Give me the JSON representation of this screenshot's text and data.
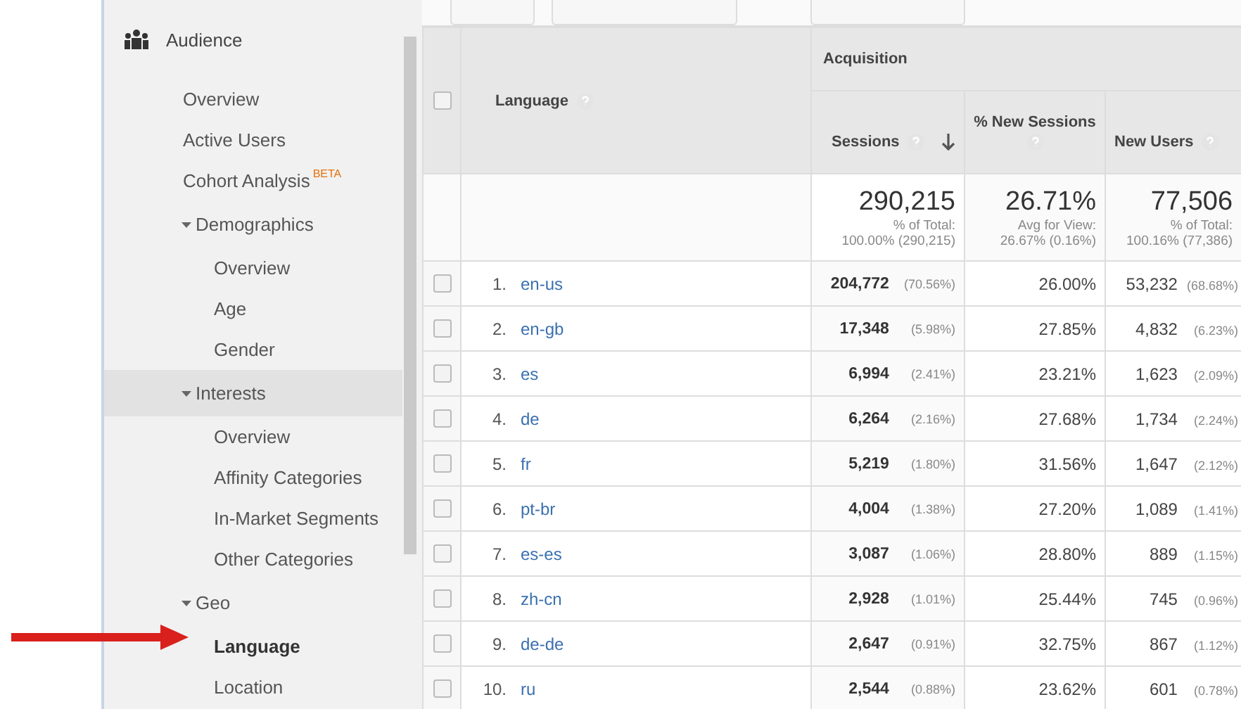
{
  "sidebar": {
    "section": {
      "label": "Audience",
      "children": [
        {
          "label": "Overview",
          "selected": false,
          "hovered": false
        },
        {
          "label": "Active Users",
          "selected": false,
          "hovered": false
        },
        {
          "label": "Cohort Analysis",
          "badge": "BETA",
          "selected": false,
          "hovered": false
        },
        {
          "label": "Demographics",
          "expanded": true,
          "selected": false,
          "hovered": false,
          "children": [
            {
              "label": "Overview",
              "selected": false,
              "hovered": false
            },
            {
              "label": "Age",
              "selected": false,
              "hovered": false
            },
            {
              "label": "Gender",
              "selected": false,
              "hovered": false
            }
          ]
        },
        {
          "label": "Interests",
          "expanded": true,
          "selected": false,
          "hovered": true,
          "children": [
            {
              "label": "Overview",
              "selected": false,
              "hovered": false
            },
            {
              "label": "Affinity Categories",
              "selected": false,
              "hovered": false
            },
            {
              "label": "In-Market Segments",
              "selected": false,
              "hovered": false
            },
            {
              "label": "Other Categories",
              "selected": false,
              "hovered": false
            }
          ]
        },
        {
          "label": "Geo",
          "expanded": true,
          "selected": false,
          "hovered": false,
          "children": [
            {
              "label": "Language",
              "selected": true,
              "hovered": false
            },
            {
              "label": "Location",
              "selected": false,
              "hovered": false
            }
          ]
        }
      ]
    }
  },
  "table": {
    "header_checkbox": {
      "checked": false
    },
    "dimension": "Language",
    "group": "Acquisition",
    "columns": [
      {
        "label": "Sessions",
        "sorted": true
      },
      {
        "label": "% New Sessions",
        "sorted": false
      },
      {
        "label": "New Users",
        "sorted": false
      }
    ],
    "totals": [
      {
        "value": "290,215",
        "caption": "% of Total:",
        "detail": "100.00% (290,215)"
      },
      {
        "value": "26.71%",
        "caption": "Avg for View:",
        "detail": "26.67% (0.16%)"
      },
      {
        "value": "77,506",
        "caption": "% of Total:",
        "detail": "100.16% (77,386)"
      }
    ],
    "rows": [
      {
        "checked": false,
        "index": "1.",
        "language": "en-us",
        "sessions": "204,772",
        "sessions_pct": "(70.56%)",
        "new_sessions": "26.00%",
        "new_users": "53,232",
        "new_users_pct": "(68.68%)"
      },
      {
        "checked": false,
        "index": "2.",
        "language": "en-gb",
        "sessions": "17,348",
        "sessions_pct": "(5.98%)",
        "new_sessions": "27.85%",
        "new_users": "4,832",
        "new_users_pct": "(6.23%)"
      },
      {
        "checked": false,
        "index": "3.",
        "language": "es",
        "sessions": "6,994",
        "sessions_pct": "(2.41%)",
        "new_sessions": "23.21%",
        "new_users": "1,623",
        "new_users_pct": "(2.09%)"
      },
      {
        "checked": false,
        "index": "4.",
        "language": "de",
        "sessions": "6,264",
        "sessions_pct": "(2.16%)",
        "new_sessions": "27.68%",
        "new_users": "1,734",
        "new_users_pct": "(2.24%)"
      },
      {
        "checked": false,
        "index": "5.",
        "language": "fr",
        "sessions": "5,219",
        "sessions_pct": "(1.80%)",
        "new_sessions": "31.56%",
        "new_users": "1,647",
        "new_users_pct": "(2.12%)"
      },
      {
        "checked": false,
        "index": "6.",
        "language": "pt-br",
        "sessions": "4,004",
        "sessions_pct": "(1.38%)",
        "new_sessions": "27.20%",
        "new_users": "1,089",
        "new_users_pct": "(1.41%)"
      },
      {
        "checked": false,
        "index": "7.",
        "language": "es-es",
        "sessions": "3,087",
        "sessions_pct": "(1.06%)",
        "new_sessions": "28.80%",
        "new_users": "889",
        "new_users_pct": "(1.15%)"
      },
      {
        "checked": false,
        "index": "8.",
        "language": "zh-cn",
        "sessions": "2,928",
        "sessions_pct": "(1.01%)",
        "new_sessions": "25.44%",
        "new_users": "745",
        "new_users_pct": "(0.96%)"
      },
      {
        "checked": false,
        "index": "9.",
        "language": "de-de",
        "sessions": "2,647",
        "sessions_pct": "(0.91%)",
        "new_sessions": "32.75%",
        "new_users": "867",
        "new_users_pct": "(1.12%)"
      },
      {
        "checked": false,
        "index": "10.",
        "language": "ru",
        "sessions": "2,544",
        "sessions_pct": "(0.88%)",
        "new_sessions": "23.62%",
        "new_users": "601",
        "new_users_pct": "(0.78%)"
      }
    ]
  }
}
